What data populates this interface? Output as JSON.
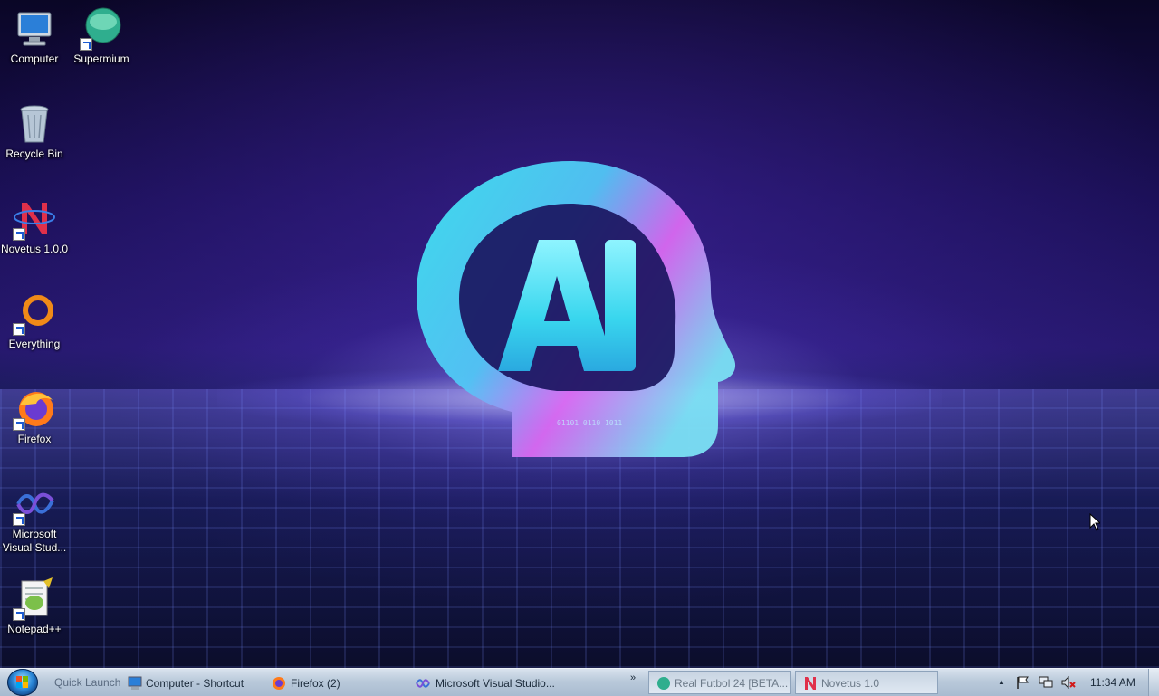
{
  "desktop": {
    "wallpaper_text": "AI",
    "icons": [
      {
        "label": "Computer",
        "icon": "computer-icon"
      },
      {
        "label": "Supermium",
        "icon": "supermium-icon"
      },
      {
        "label": "Recycle Bin",
        "icon": "recycle-bin-icon"
      },
      {
        "label": "Novetus 1.0.0",
        "icon": "novetus-icon"
      },
      {
        "label": "Everything",
        "icon": "everything-icon"
      },
      {
        "label": "Firefox",
        "icon": "firefox-icon"
      },
      {
        "label": "Microsoft Visual Stud...",
        "icon": "visual-studio-icon"
      },
      {
        "label": "Notepad++",
        "icon": "notepadpp-icon"
      }
    ]
  },
  "taskbar": {
    "quick_launch_label": "Quick Launch",
    "buttons": [
      {
        "label": "Computer - Shortcut",
        "icon": "computer-icon"
      },
      {
        "label": "Firefox (2)",
        "icon": "firefox-icon"
      },
      {
        "label": "Microsoft Visual Studio...",
        "icon": "visual-studio-icon"
      },
      {
        "label": "Real Futbol 24 [BETA...",
        "icon": "supermium-icon"
      },
      {
        "label": "Novetus 1.0",
        "icon": "novetus-icon"
      }
    ],
    "overflow_chevron": "»",
    "tray": {
      "expand_arrow": "▲",
      "icons": [
        "flag-icon",
        "network-icon",
        "volume-muted-icon"
      ],
      "clock": "11:34 AM"
    }
  },
  "colors": {
    "taskbar_bg": "#b9c9da",
    "wallpaper_dark": "#0a0626",
    "wallpaper_mid": "#26186e",
    "logo_cyan": "#3ee0f0",
    "logo_magenta": "#e85cf0"
  }
}
